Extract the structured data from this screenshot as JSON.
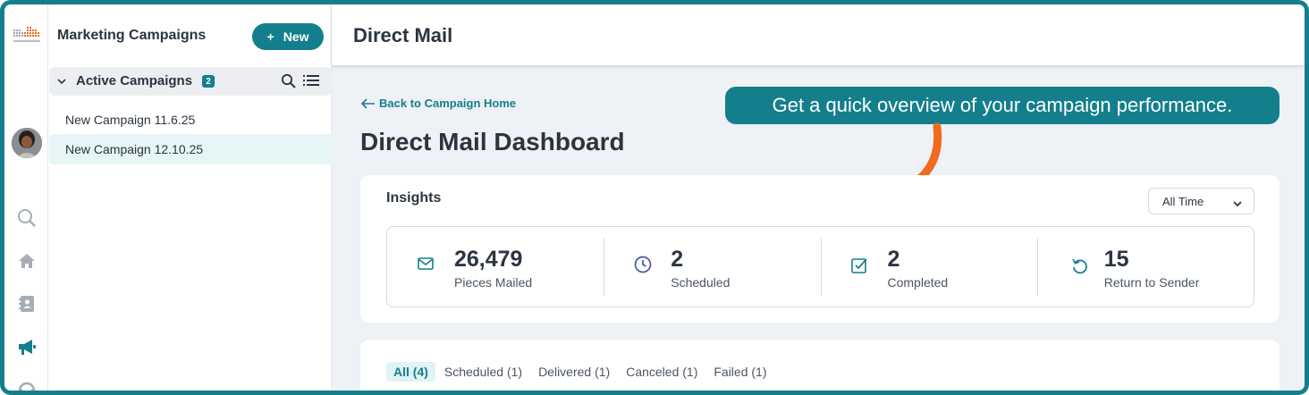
{
  "brand": {
    "accent": "#147f8c",
    "callout_arrow": "#f06a1f"
  },
  "sidebar": {
    "icons": [
      "search-icon",
      "home-icon",
      "contacts-icon",
      "megaphone-icon",
      "headset-icon"
    ]
  },
  "panel": {
    "title": "Marketing Campaigns",
    "new_button": "New",
    "group": {
      "label": "Active Campaigns",
      "count": "2"
    },
    "campaigns": [
      "New Campaign 11.6.25",
      "New Campaign 12.10.25"
    ],
    "selected_index": 1
  },
  "header": {
    "title": "Direct Mail"
  },
  "main": {
    "back_link": "Back to Campaign Home",
    "page_title": "Direct Mail Dashboard",
    "callout": "Get a quick overview of your campaign performance.",
    "insights": {
      "title": "Insights",
      "range": "All Time",
      "stats": [
        {
          "value": "26,479",
          "label": "Pieces Mailed",
          "icon": "mail-icon"
        },
        {
          "value": "2",
          "label": "Scheduled",
          "icon": "clock-icon"
        },
        {
          "value": "2",
          "label": "Completed",
          "icon": "check-square-icon"
        },
        {
          "value": "15",
          "label": "Return to Sender",
          "icon": "return-icon"
        }
      ]
    },
    "tabs": [
      "All (4)",
      "Scheduled (1)",
      "Delivered (1)",
      "Canceled (1)",
      "Failed (1)"
    ]
  }
}
